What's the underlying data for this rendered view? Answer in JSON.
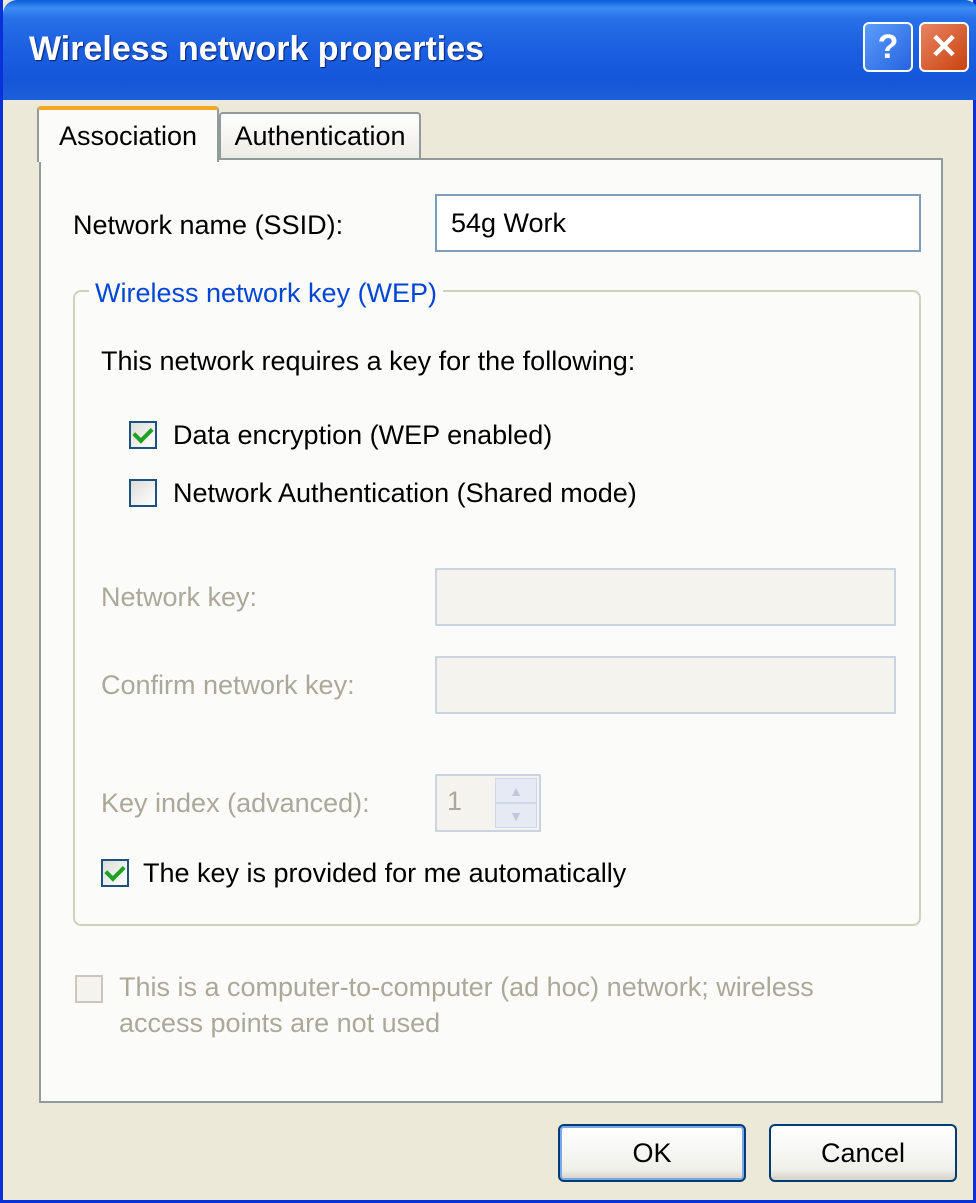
{
  "window": {
    "title": "Wireless network properties",
    "help_glyph": "?",
    "close_glyph": "✕"
  },
  "tabs": [
    {
      "label": "Association",
      "active": true
    },
    {
      "label": "Authentication",
      "active": false
    }
  ],
  "ssid": {
    "label": "Network name (SSID):",
    "value": "54g Work"
  },
  "wep_group": {
    "title": "Wireless network key (WEP)",
    "intro": "This network requires a key for the following:",
    "data_encryption": {
      "label": "Data encryption (WEP enabled)",
      "checked": true
    },
    "network_auth": {
      "label": "Network Authentication (Shared mode)",
      "checked": false
    },
    "network_key": {
      "label": "Network key:",
      "value": ""
    },
    "confirm_key": {
      "label": "Confirm network key:",
      "value": ""
    },
    "key_index": {
      "label": "Key index (advanced):",
      "value": "1"
    },
    "auto_key": {
      "label": "The key is provided for me automatically",
      "checked": true
    }
  },
  "adhoc": {
    "line1": "This is a computer-to-computer (ad hoc) network; wireless",
    "line2": "access points are not used",
    "checked": false
  },
  "buttons": {
    "ok": "OK",
    "cancel": "Cancel"
  },
  "colors": {
    "titlebar": "#1B5FE0",
    "group_title": "#0046D5",
    "disabled_text": "#ACA899",
    "active_tab_accent": "#F5A623"
  }
}
